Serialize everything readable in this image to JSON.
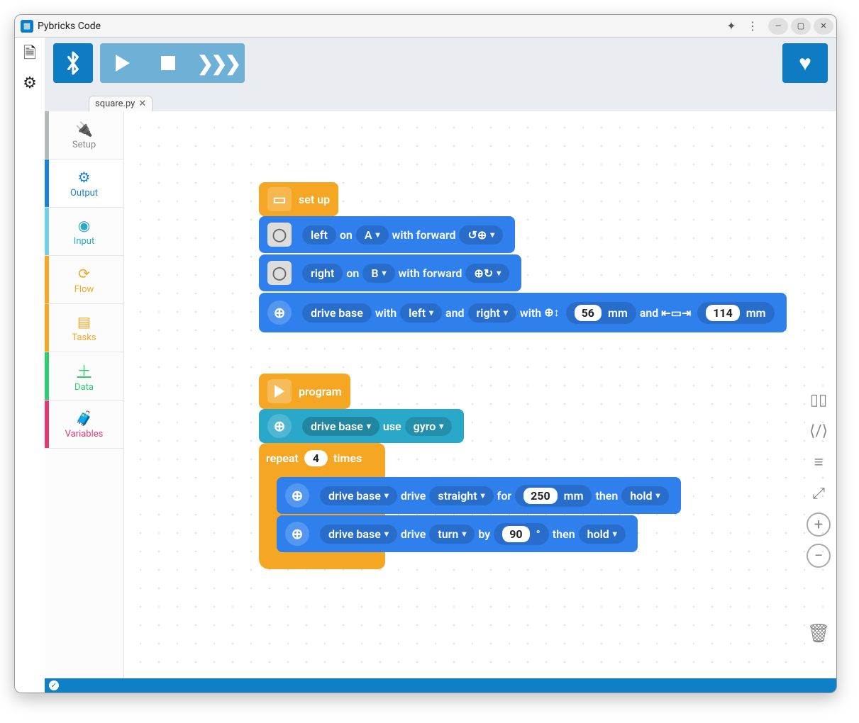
{
  "app": {
    "title": "Pybricks Code"
  },
  "tabs": {
    "file": "square.py"
  },
  "palette": [
    {
      "label": "Setup",
      "icon": "⚡",
      "color": "#9aa0a6",
      "strip": "#b5b8bd"
    },
    {
      "label": "Output",
      "icon": "⚙",
      "color": "#1a82d6",
      "strip": "#1a82d6"
    },
    {
      "label": "Input",
      "icon": "👁",
      "color": "#2aa8c9",
      "strip": "#6fd0e8"
    },
    {
      "label": "Flow",
      "icon": "↺",
      "color": "#f5a623",
      "strip": "#f5a623"
    },
    {
      "label": "Tasks",
      "icon": "▣",
      "color": "#f5a623",
      "strip": "#f5a623"
    },
    {
      "label": "Data",
      "icon": "＋",
      "color": "#2ecc71",
      "strip": "#2ecc71"
    },
    {
      "label": "Variables",
      "icon": "🧳",
      "color": "#e53976",
      "strip": "#e53976"
    }
  ],
  "blocks": {
    "setup_label": "set up",
    "motor1": {
      "name": "left",
      "on": "on",
      "port": "A",
      "with_fwd": "with forward"
    },
    "motor2": {
      "name": "right",
      "on": "on",
      "port": "B",
      "with_fwd": "with forward"
    },
    "drivebase_def": {
      "name": "drive base",
      "with": "with",
      "left": "left",
      "and": "and",
      "right": "right",
      "with2": "with",
      "wheel_diam": "56",
      "mm": "mm",
      "and2": "and",
      "axle": "114",
      "mm2": "mm"
    },
    "program_label": "program",
    "use": {
      "db": "drive base",
      "use": "use",
      "mode": "gyro"
    },
    "repeat": {
      "repeat": "repeat",
      "count": "4",
      "times": "times"
    },
    "drive_straight": {
      "db": "drive base",
      "drive": "drive",
      "mode": "straight",
      "for": "for",
      "dist": "250",
      "mm": "mm",
      "then": "then",
      "action": "hold"
    },
    "drive_turn": {
      "db": "drive base",
      "drive": "drive",
      "mode": "turn",
      "by": "by",
      "angle": "90",
      "deg": "°",
      "then": "then",
      "action": "hold"
    }
  }
}
